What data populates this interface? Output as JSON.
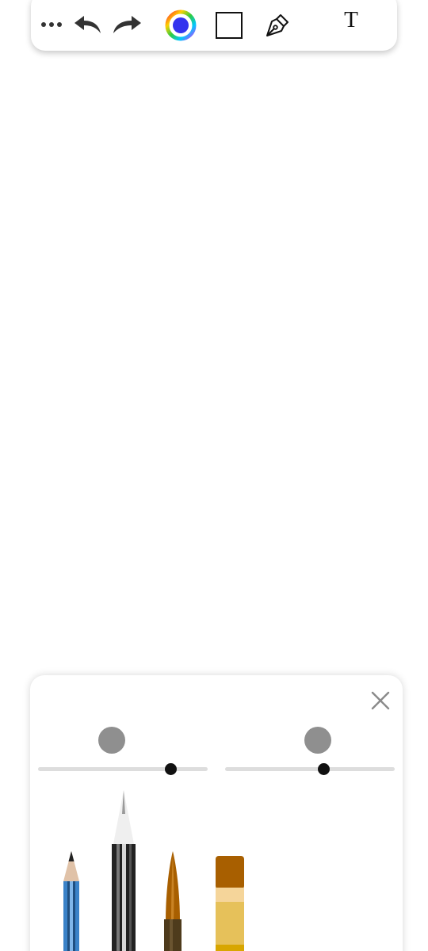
{
  "toolbar": {
    "items": [
      {
        "name": "more-options",
        "icon": "more-horizontal-icon"
      },
      {
        "name": "undo",
        "icon": "undo-arrow-icon"
      },
      {
        "name": "redo",
        "icon": "redo-arrow-icon"
      },
      {
        "name": "color-picker",
        "icon": "color-wheel-icon",
        "selected_color": "#3333ee"
      },
      {
        "name": "shape",
        "icon": "square-outline-icon"
      },
      {
        "name": "pen",
        "icon": "pen-nib-icon"
      },
      {
        "name": "text",
        "icon": "text-t-icon"
      }
    ],
    "text_tool_label": "T"
  },
  "brush_panel": {
    "close_icon": "close-x-icon",
    "size_slider": {
      "value": 0.78,
      "preview_color": "#8f8f8f"
    },
    "opacity_slider": {
      "value": 0.58,
      "preview_color": "#8f8f8f"
    },
    "brushes": [
      {
        "name": "pencil",
        "icon": "pencil-icon",
        "color": "#3a82c8"
      },
      {
        "name": "fineliner",
        "icon": "fineliner-pen-icon",
        "color": "#2a2a2a"
      },
      {
        "name": "round-brush",
        "icon": "round-paintbrush-icon",
        "color": "#a85f00"
      },
      {
        "name": "flat-brush",
        "icon": "flat-paintbrush-icon",
        "color": "#a85f00"
      }
    ]
  }
}
